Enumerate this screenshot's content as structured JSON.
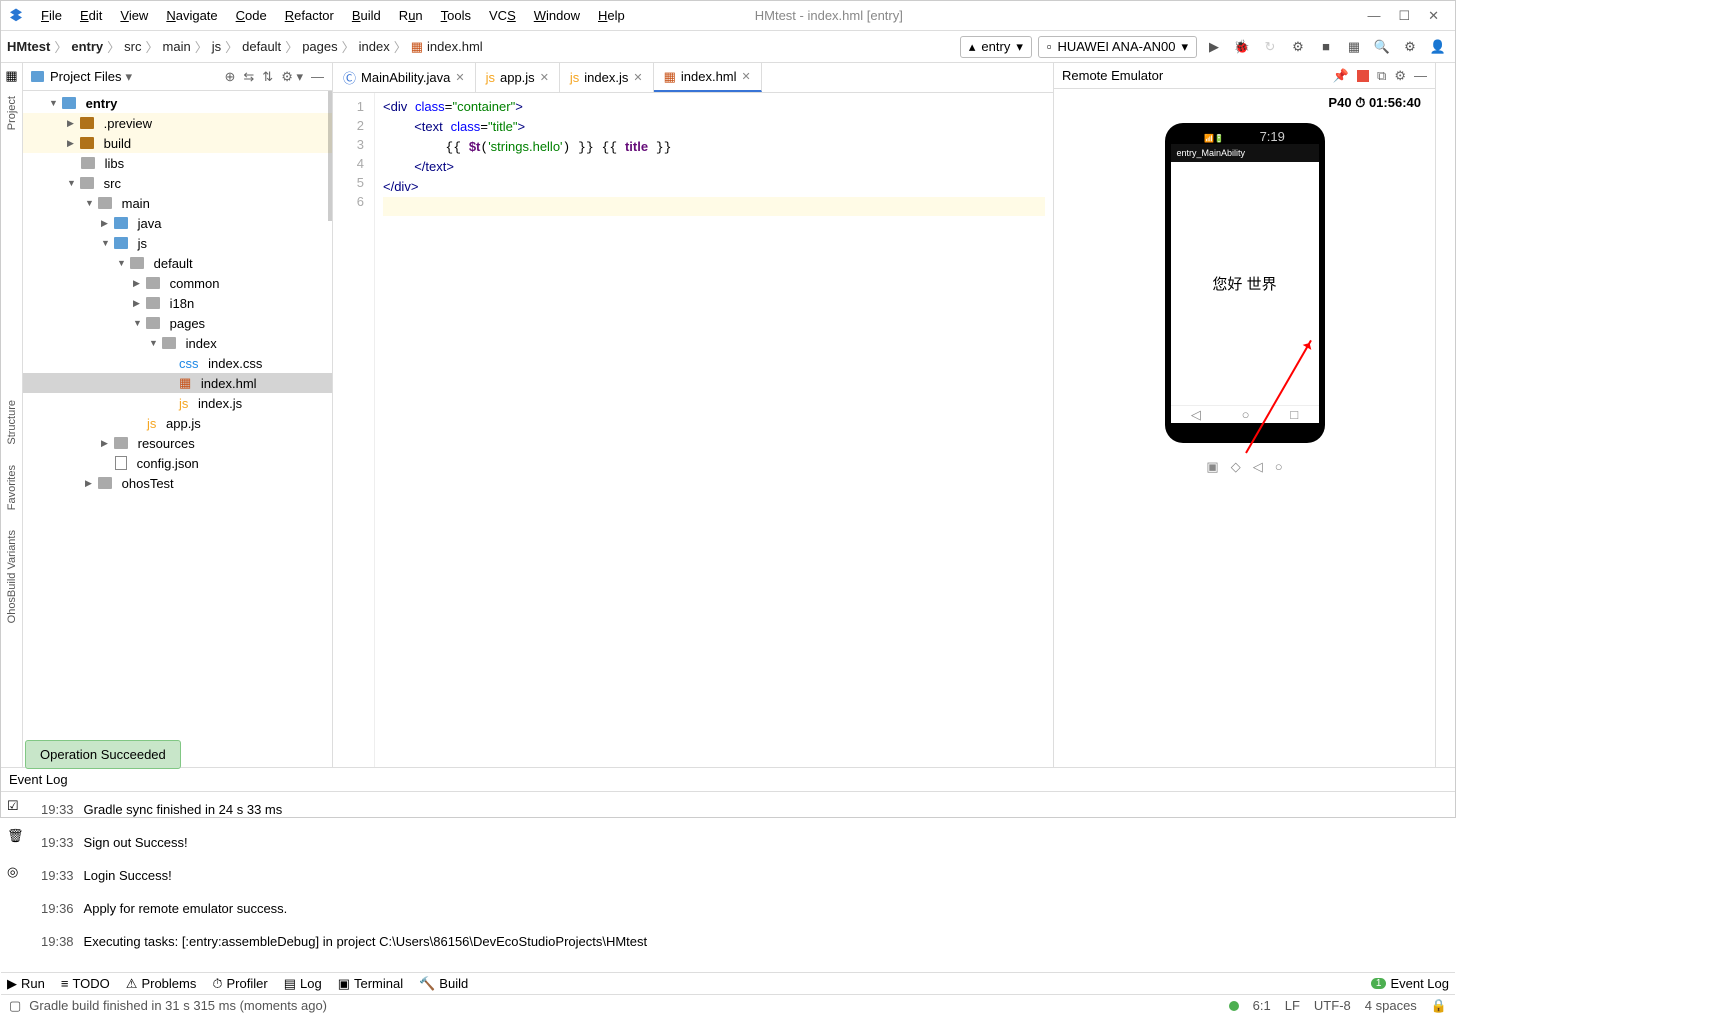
{
  "window": {
    "title": "HMtest - index.hml [entry]"
  },
  "menu": [
    "File",
    "Edit",
    "View",
    "Navigate",
    "Code",
    "Refactor",
    "Build",
    "Run",
    "Tools",
    "VCS",
    "Window",
    "Help"
  ],
  "breadcrumb": [
    "HMtest",
    "entry",
    "src",
    "main",
    "js",
    "default",
    "pages",
    "index",
    "index.hml"
  ],
  "run_config": {
    "module": "entry",
    "device": "HUAWEI ANA-AN00"
  },
  "project_header": {
    "title": "Project Files"
  },
  "tree": {
    "entry": "entry",
    "preview": ".preview",
    "build": "build",
    "libs": "libs",
    "src": "src",
    "main": "main",
    "java": "java",
    "js": "js",
    "default": "default",
    "common": "common",
    "i18n": "i18n",
    "pages": "pages",
    "index": "index",
    "index_css": "index.css",
    "index_hml": "index.hml",
    "index_js": "index.js",
    "app_js": "app.js",
    "resources": "resources",
    "config": "config.json",
    "ohostest": "ohosTest"
  },
  "tabs": [
    {
      "icon": "java",
      "label": "MainAbility.java",
      "active": false
    },
    {
      "icon": "js",
      "label": "app.js",
      "active": false
    },
    {
      "icon": "js",
      "label": "index.js",
      "active": false
    },
    {
      "icon": "hml",
      "label": "index.hml",
      "active": true
    }
  ],
  "code": {
    "l1": [
      "<",
      "div",
      " ",
      "class",
      "=",
      "\"container\"",
      ">"
    ],
    "l2": [
      "<",
      "text",
      " ",
      "class",
      "=",
      "\"title\"",
      ">"
    ],
    "l3": [
      "{{ ",
      "$t('strings.hello')",
      " }}",
      " ",
      "{{ ",
      "title",
      " }}"
    ],
    "l4": [
      "</",
      "text",
      ">"
    ],
    "l5": [
      "</",
      "div",
      ">"
    ],
    "lines": [
      "1",
      "2",
      "3",
      "4",
      "5",
      "6"
    ]
  },
  "emulator": {
    "title": "Remote Emulator",
    "device": "P40",
    "time": "01:56:40",
    "app_title": "entry_MainAbility",
    "content": "您好 世界",
    "status_time": "7:19"
  },
  "event_log": {
    "title": "Event Log",
    "rows": [
      {
        "t": "19:33",
        "m": "Gradle sync finished in 24 s 33 ms"
      },
      {
        "t": "19:33",
        "m": "Sign out Success!"
      },
      {
        "t": "19:33",
        "m": "Login Success!"
      },
      {
        "t": "19:36",
        "m": "Apply for remote emulator success."
      },
      {
        "t": "19:38",
        "m": "Executing tasks: [:entry:assembleDebug] in project C:\\Users\\86156\\DevEcoStudioProjects\\HMtest"
      }
    ]
  },
  "bottom": {
    "run": "Run",
    "todo": "TODO",
    "problems": "Problems",
    "profiler": "Profiler",
    "log": "Log",
    "terminal": "Terminal",
    "build": "Build",
    "eventlog": "Event Log"
  },
  "status": {
    "msg": "Gradle build finished in 31 s 315 ms (moments ago)",
    "pos": "6:1",
    "enc": "LF",
    "charset": "UTF-8",
    "indent": "4 spaces"
  },
  "toast": "Operation Succeeded",
  "side_left": {
    "project": "Project",
    "structure": "Structure",
    "favorites": "Favorites",
    "variants": "OhosBuild Variants"
  }
}
